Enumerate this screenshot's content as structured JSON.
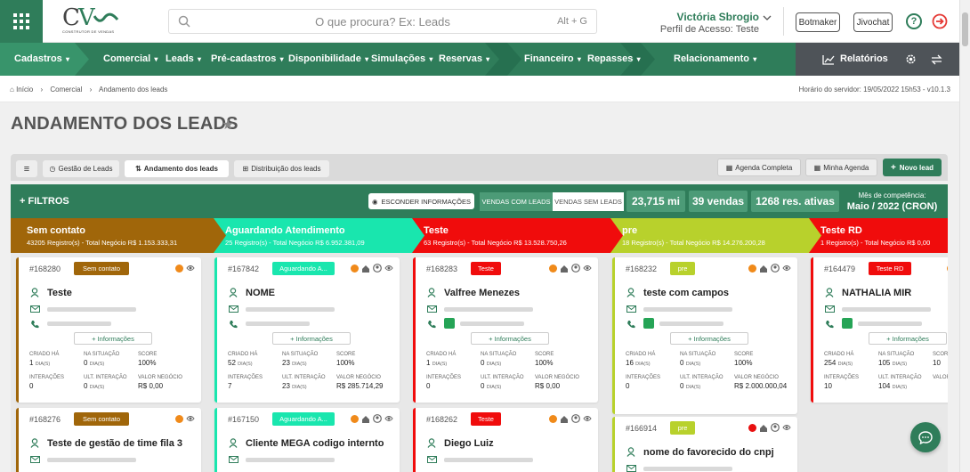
{
  "search": {
    "placeholder": "O que procura? Ex: Leads",
    "shortcut": "Alt + G"
  },
  "user": {
    "name": "Victória Sbrogio",
    "profile": "Perfil de Acesso: Teste"
  },
  "top_buttons": {
    "botmaker": "Botmaker",
    "jivochat": "Jivochat"
  },
  "logo": {
    "main_c": "C",
    "main_v": "V",
    "sub": "CONSTRUTOR DE VENDAS"
  },
  "nav": {
    "items": [
      "Cadastros",
      "Comercial",
      "Leads",
      "Pré-cadastros",
      "Disponibilidade",
      "Simulações",
      "Reservas",
      "Financeiro",
      "Repasses",
      "Relacionamento"
    ],
    "reports": "Relatórios"
  },
  "breadcrumb": {
    "items": [
      "Início",
      "Comercial",
      "Andamento dos leads"
    ],
    "server_time": "Horário do servidor: 19/05/2022 15h53 - v10.1.3"
  },
  "page_title": "ANDAMENTO DOS LEADS",
  "toolbar": {
    "tabs": [
      "Gestão de Leads",
      "Andamento dos leads",
      "Distribuição dos leads"
    ],
    "agenda_completa": "Agenda Completa",
    "minha_agenda": "Minha Agenda",
    "novo_lead": "Novo lead"
  },
  "filters": {
    "label": "FILTROS",
    "hide_info": "ESCONDER INFORMAÇÕES",
    "com_leads": "VENDAS COM LEADS",
    "sem_leads": "VENDAS SEM LEADS",
    "stats": [
      "23,715 mi",
      "39 vendas",
      "1268 res. ativas"
    ],
    "competencia_label": "Mês de competência:",
    "competencia_value": "Maio / 2022 (CRON)"
  },
  "stages": [
    {
      "name": "Sem contato",
      "summary": "43205 Registro(s) - Total Negócio R$ 1.153.333,31",
      "color": "#a0660a",
      "text": "#ffffff"
    },
    {
      "name": "Aguardando Atendimento",
      "summary": "25 Registro(s) - Total Negócio R$ 6.952.381,09",
      "color": "#19e6ae",
      "text": "#ffffff"
    },
    {
      "name": "Teste",
      "summary": "63 Registro(s) - Total Negócio R$ 13.528.750,26",
      "color": "#f00c0c",
      "text": "#ffffff"
    },
    {
      "name": "pre",
      "summary": "18 Registro(s) - Total Negócio R$ 14.276.200,28",
      "color": "#b8d12c",
      "text": "#ffffff"
    },
    {
      "name": "Teste RD",
      "summary": "1 Registro(s) - Total Negócio R$ 0,00",
      "color": "#f00c0c",
      "text": "#ffffff"
    }
  ],
  "labels": {
    "informacoes": "+ Informações",
    "criado_ha": "CRIADO HÁ",
    "na_situacao": "NA SITUAÇÃO",
    "score": "SCORE",
    "interacoes": "INTERAÇÕES",
    "ult_interacao": "ULT. INTERAÇÃO",
    "valor_negocio": "VALOR NEGÓCIO",
    "dias": "DIA(S)"
  },
  "columns": [
    {
      "badge_color": "#a0660a",
      "cards": [
        {
          "id": "#168280",
          "badge": "Sem contato",
          "status_dot": "#f08a1a",
          "name": "Teste",
          "wa": false,
          "criado": "1",
          "situacao": "0",
          "score": "100%",
          "interacoes": "0",
          "ult": "0",
          "valor": "R$ 0,00"
        },
        {
          "id": "#168276",
          "badge": "Sem contato",
          "status_dot": "#f08a1a",
          "name": "Teste de gestão de time fila 3"
        }
      ]
    },
    {
      "badge_color": "#19e6ae",
      "cards": [
        {
          "id": "#167842",
          "badge": "Aguardando A...",
          "status_dot": "#f08a1a",
          "name": "NOME",
          "wa": false,
          "criado": "52",
          "situacao": "23",
          "score": "100%",
          "interacoes": "7",
          "ult": "23",
          "valor": "R$ 285.714,29"
        },
        {
          "id": "#167150",
          "badge": "Aguardando A...",
          "status_dot": "#f08a1a",
          "name": "Cliente MEGA codigo internto"
        }
      ]
    },
    {
      "badge_color": "#f00c0c",
      "cards": [
        {
          "id": "#168283",
          "badge": "Teste",
          "status_dot": "#f08a1a",
          "name": "Valfree Menezes",
          "wa": true,
          "criado": "1",
          "situacao": "0",
          "score": "100%",
          "interacoes": "0",
          "ult": "0",
          "valor": "R$ 0,00"
        },
        {
          "id": "#168262",
          "badge": "Teste",
          "status_dot": "#f08a1a",
          "name": "Diego Luiz"
        }
      ]
    },
    {
      "badge_color": "#b8d12c",
      "cards": [
        {
          "id": "#168232",
          "badge": "pre",
          "status_dot": "#f08a1a",
          "name": "teste com campos",
          "wa": true,
          "criado": "16",
          "situacao": "0",
          "score": "100%",
          "interacoes": "0",
          "ult": "0",
          "valor": "R$ 2.000.000,04"
        },
        {
          "id": "#166914",
          "badge": "pre",
          "status_dot": "#e81010",
          "name": "nome do favorecido do cnpj"
        }
      ]
    },
    {
      "badge_color": "#f00c0c",
      "cards": [
        {
          "id": "#164479",
          "badge": "Teste RD",
          "status_dot": "#f08a1a",
          "name": "NATHALIA MIR",
          "wa": true,
          "criado": "254",
          "situacao": "105",
          "score": "10",
          "interacoes": "10",
          "ult": "104",
          "valor": ""
        }
      ]
    }
  ]
}
